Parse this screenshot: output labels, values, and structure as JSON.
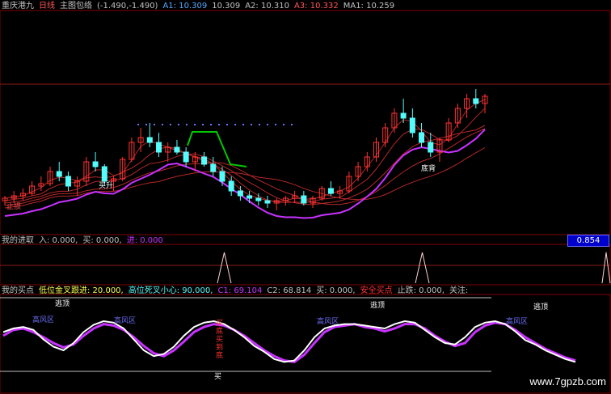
{
  "header_main": {
    "title": "重庆港九",
    "period": "日线",
    "indicator": "主图包络",
    "params": "(-1.490,-1.490)",
    "a1": "A1: 10.309",
    "a1_val": "10.309",
    "a2": "A2: 10.310",
    "a3": "A3: 10.332",
    "ma1": "MA1: 10.259"
  },
  "header_sub1": {
    "name": "我的进取",
    "in": "入: 0.000,",
    "buy": "买: 0.000,",
    "enter": "进: 0.000"
  },
  "badge": "0.854",
  "header_sub2": {
    "name": "我的买点",
    "low": "低位金叉跟进: 20.000,",
    "high": "高位死叉小心: 90.000,",
    "c1": "C1: 69.104",
    "c2": "C2: 68.814",
    "buy": "买: 0.000,",
    "safe": "安全买点",
    "stop": "止跌: 0.000,",
    "watch": "关注:"
  },
  "labels": {
    "left_label": "止损",
    "bottom_label": "底背",
    "buy_up": "买升",
    "top1": "逃顶",
    "top2": "逃顶",
    "top3": "逃顶",
    "zone1": "高风区",
    "zone2": "高风区",
    "zone3": "高风区",
    "zone4": "高风区",
    "buy_marker": "买",
    "vertical_text": "买底买到底"
  },
  "watermark": "www.7gpzb.com",
  "colors": {
    "up": "#ff3232",
    "down": "#54fcfc",
    "white_line": "#ffffff",
    "magenta": "#c832ff",
    "green": "#00c800",
    "red_band": "#b42828"
  },
  "chart_data": {
    "type": "candlestick",
    "candles": [
      [
        10.0,
        10.1,
        9.9,
        10.05
      ],
      [
        10.05,
        10.2,
        9.95,
        10.1
      ],
      [
        10.1,
        10.25,
        10.0,
        10.15
      ],
      [
        10.15,
        10.4,
        10.1,
        10.3
      ],
      [
        10.3,
        10.5,
        10.2,
        10.35
      ],
      [
        10.35,
        10.7,
        10.3,
        10.6
      ],
      [
        10.6,
        10.8,
        10.4,
        10.5
      ],
      [
        10.5,
        10.6,
        10.2,
        10.3
      ],
      [
        10.3,
        10.5,
        10.1,
        10.4
      ],
      [
        10.4,
        10.9,
        10.3,
        10.8
      ],
      [
        10.8,
        11.0,
        10.6,
        10.7
      ],
      [
        10.7,
        10.75,
        10.3,
        10.4
      ],
      [
        10.4,
        10.5,
        10.2,
        10.45
      ],
      [
        10.45,
        10.9,
        10.4,
        10.85
      ],
      [
        10.85,
        11.3,
        10.8,
        11.2
      ],
      [
        11.2,
        11.5,
        11.0,
        11.3
      ],
      [
        11.3,
        11.6,
        11.1,
        11.2
      ],
      [
        11.2,
        11.4,
        10.9,
        11.0
      ],
      [
        11.0,
        11.2,
        10.8,
        11.1
      ],
      [
        11.1,
        11.25,
        10.95,
        11.0
      ],
      [
        11.0,
        11.1,
        10.7,
        10.8
      ],
      [
        10.8,
        11.0,
        10.6,
        10.9
      ],
      [
        10.9,
        11.0,
        10.7,
        10.75
      ],
      [
        10.75,
        10.9,
        10.5,
        10.6
      ],
      [
        10.6,
        10.7,
        10.3,
        10.4
      ],
      [
        10.4,
        10.5,
        10.1,
        10.2
      ],
      [
        10.2,
        10.3,
        10.0,
        10.1
      ],
      [
        10.1,
        10.2,
        9.95,
        10.05
      ],
      [
        10.05,
        10.15,
        9.9,
        10.0
      ],
      [
        10.0,
        10.1,
        9.85,
        9.95
      ],
      [
        9.95,
        10.05,
        9.8,
        10.0
      ],
      [
        10.0,
        10.1,
        9.9,
        10.05
      ],
      [
        10.05,
        10.2,
        9.95,
        10.1
      ],
      [
        10.1,
        10.2,
        9.9,
        9.95
      ],
      [
        9.95,
        10.1,
        9.85,
        10.05
      ],
      [
        10.05,
        10.3,
        10.0,
        10.25
      ],
      [
        10.25,
        10.4,
        10.1,
        10.15
      ],
      [
        10.15,
        10.3,
        10.05,
        10.2
      ],
      [
        10.2,
        10.6,
        10.15,
        10.5
      ],
      [
        10.5,
        10.8,
        10.4,
        10.7
      ],
      [
        10.7,
        11.0,
        10.6,
        10.9
      ],
      [
        10.9,
        11.3,
        10.8,
        11.2
      ],
      [
        11.2,
        11.6,
        11.1,
        11.5
      ],
      [
        11.5,
        11.9,
        11.4,
        11.8
      ],
      [
        11.8,
        12.1,
        11.6,
        11.7
      ],
      [
        11.7,
        11.9,
        11.3,
        11.4
      ],
      [
        11.4,
        11.6,
        11.1,
        11.2
      ],
      [
        11.2,
        11.4,
        10.9,
        11.0
      ],
      [
        11.0,
        11.3,
        10.8,
        11.25
      ],
      [
        11.25,
        11.7,
        11.2,
        11.6
      ],
      [
        11.6,
        12.0,
        11.5,
        11.9
      ],
      [
        11.9,
        12.2,
        11.7,
        12.1
      ],
      [
        12.1,
        12.3,
        11.9,
        12.0
      ],
      [
        12.0,
        12.2,
        11.8,
        12.15
      ]
    ],
    "oscillator_white": [
      55,
      60,
      62,
      58,
      45,
      35,
      30,
      40,
      55,
      65,
      70,
      68,
      60,
      45,
      30,
      22,
      25,
      35,
      50,
      62,
      68,
      70,
      66,
      58,
      48,
      36,
      28,
      18,
      14,
      16,
      30,
      48,
      60,
      64,
      66,
      66,
      64,
      62,
      60,
      66,
      70,
      68,
      58,
      48,
      40,
      38,
      48,
      62,
      68,
      70,
      66,
      56,
      44,
      38,
      30,
      24,
      18,
      14
    ],
    "oscillator_magenta": [
      50,
      58,
      60,
      55,
      48,
      40,
      34,
      38,
      50,
      60,
      66,
      64,
      58,
      48,
      36,
      26,
      22,
      30,
      42,
      55,
      62,
      66,
      64,
      58,
      50,
      40,
      30,
      22,
      16,
      14,
      24,
      40,
      55,
      62,
      64,
      66,
      62,
      60,
      56,
      60,
      66,
      66,
      60,
      50,
      42,
      36,
      40,
      55,
      64,
      68,
      66,
      58,
      48,
      40,
      32,
      26,
      20,
      16
    ],
    "y_scale": {
      "ref_lines": [
        20,
        90
      ]
    }
  }
}
